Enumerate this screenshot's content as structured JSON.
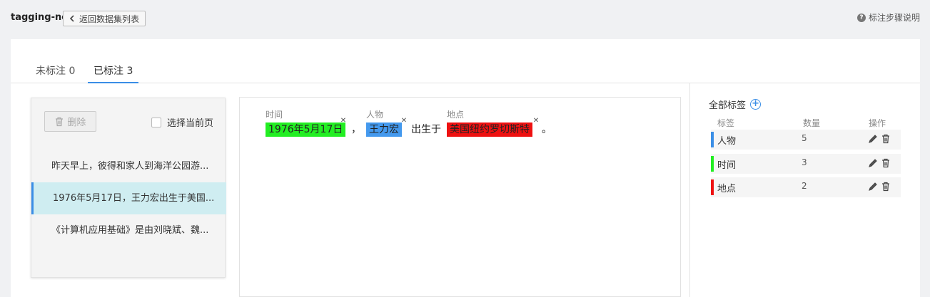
{
  "header": {
    "app_title": "tagging-ner",
    "back_label": "返回数据集列表",
    "help_label": "标注步骤说明"
  },
  "tabs": [
    {
      "label": "未标注 0",
      "active": false
    },
    {
      "label": "已标注 3",
      "active": true
    }
  ],
  "list": {
    "delete_label": "删除",
    "select_page_label": "选择当前页",
    "items": [
      {
        "text": "昨天早上，彼得和家人到海洋公园游...",
        "selected": false
      },
      {
        "text": "1976年5月17日，王力宏出生于美国...",
        "selected": true
      },
      {
        "text": "《计算机应用基础》是由刘晓斌、魏...",
        "selected": false
      }
    ]
  },
  "editor": {
    "entities": [
      {
        "label": "时间",
        "text": "1976年5月17日",
        "color": "#22ee22"
      },
      {
        "label": "人物",
        "text": "王力宏",
        "color": "#4499ee"
      },
      {
        "label": "地点",
        "text": "美国纽约罗切斯特",
        "color": "#ee1111"
      }
    ],
    "comma": "，",
    "middle_text": "出生于",
    "period": "。"
  },
  "tags": {
    "title": "全部标签",
    "col_tag": "标签",
    "col_count": "数量",
    "col_ops": "操作",
    "rows": [
      {
        "name": "人物",
        "count": "5",
        "color": "#3a8ee6"
      },
      {
        "name": "时间",
        "count": "3",
        "color": "#22ee22"
      },
      {
        "name": "地点",
        "count": "2",
        "color": "#ee1111"
      }
    ]
  }
}
